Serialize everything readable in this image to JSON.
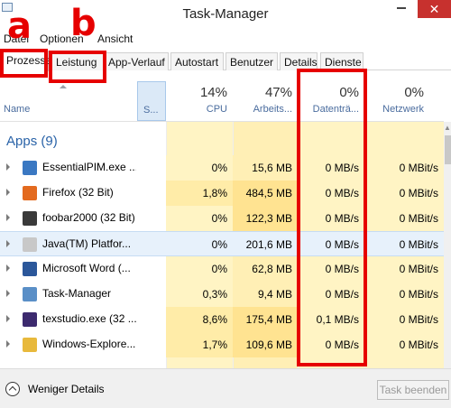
{
  "window": {
    "title": "Task-Manager",
    "close_glyph": "✕"
  },
  "menu": [
    "Datei",
    "Optionen",
    "Ansicht"
  ],
  "tabs": [
    "Prozesse",
    "Leistung",
    "App-Verlauf",
    "Autostart",
    "Benutzer",
    "Details",
    "Dienste"
  ],
  "active_tab": 0,
  "columns": {
    "name": {
      "label": "Name"
    },
    "status": {
      "label": "S..."
    },
    "cpu": {
      "percent": "14%",
      "label": "CPU"
    },
    "memory": {
      "percent": "47%",
      "label": "Arbeits..."
    },
    "disk": {
      "percent": "0%",
      "label": "Datenträ..."
    },
    "network": {
      "percent": "0%",
      "label": "Netzwerk"
    }
  },
  "group": {
    "label": "Apps (9)"
  },
  "processes": [
    {
      "name": "EssentialPIM.exe ...",
      "cpu": "0%",
      "memory": "15,6 MB",
      "disk": "0 MB/s",
      "network": "0 MBit/s",
      "icon": "essentialpim-icon",
      "icon_color": "#3a78c2"
    },
    {
      "name": "Firefox (32 Bit)",
      "cpu": "1,8%",
      "memory": "484,5 MB",
      "disk": "0 MB/s",
      "network": "0 MBit/s",
      "icon": "firefox-icon",
      "icon_color": "#e36a1f"
    },
    {
      "name": "foobar2000 (32 Bit)",
      "cpu": "0%",
      "memory": "122,3 MB",
      "disk": "0 MB/s",
      "network": "0 MBit/s",
      "icon": "foobar2000-icon",
      "icon_color": "#3a3a3a"
    },
    {
      "name": "Java(TM) Platfor...",
      "cpu": "0%",
      "memory": "201,6 MB",
      "disk": "0 MB/s",
      "network": "0 MBit/s",
      "icon": "java-icon",
      "icon_color": "#c8c8c8"
    },
    {
      "name": "Microsoft Word (...",
      "cpu": "0%",
      "memory": "62,8 MB",
      "disk": "0 MB/s",
      "network": "0 MBit/s",
      "icon": "word-icon",
      "icon_color": "#2b579a"
    },
    {
      "name": "Task-Manager",
      "cpu": "0,3%",
      "memory": "9,4 MB",
      "disk": "0 MB/s",
      "network": "0 MBit/s",
      "icon": "taskmanager-icon",
      "icon_color": "#5a8fc7"
    },
    {
      "name": "texstudio.exe (32 ...",
      "cpu": "8,6%",
      "memory": "175,4 MB",
      "disk": "0,1 MB/s",
      "network": "0 MBit/s",
      "icon": "texstudio-icon",
      "icon_color": "#3c2a6e"
    },
    {
      "name": "Windows-Explore...",
      "cpu": "1,7%",
      "memory": "109,6 MB",
      "disk": "0 MB/s",
      "network": "0 MBit/s",
      "icon": "explorer-icon",
      "icon_color": "#e8b93c"
    }
  ],
  "selected_row": 3,
  "footer": {
    "fewer_details": "Weniger Details",
    "end_task": "Task beenden"
  },
  "annotations": {
    "letter_a": "a",
    "letter_b": "b"
  },
  "colors": {
    "accent_red": "#e60000",
    "cpu_light": "#fff4c4",
    "cpu_medium": "#ffeca8",
    "mem_light": "#ffefb5",
    "mem_strong": "#ffe391",
    "header_blue": "#4a6c9e",
    "group_blue": "#2a63a8"
  }
}
